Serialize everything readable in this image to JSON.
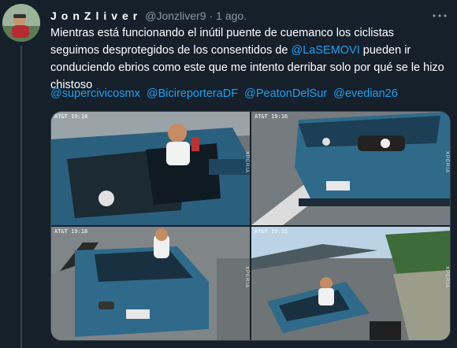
{
  "author": {
    "display_name": "JonZliver",
    "handle": "@Jonzliver9",
    "separator": "·",
    "time": "1 ago."
  },
  "tweet": {
    "text_part1": "Mientras está funcionando el inútil puente de cuemanco los ciclistas seguimos desprotegidos de los consentidos de ",
    "mention_inline": "@LaSEMOVI",
    "text_part2": " pueden ir conduciendo ebrios como este que me intento derribar solo por qué se le hizo chistoso",
    "mentions": [
      "@supercivicosmx",
      "@BicireporteraDF",
      "@PeatonDelSur",
      "@evedian26"
    ]
  },
  "media": [
    {
      "timestamp": "AT&T 19:18",
      "brand": "XPERIA"
    },
    {
      "timestamp": "AT&T 19:16",
      "brand": "XPERIA"
    },
    {
      "timestamp": "AT&T 19:18",
      "brand": "XPERIA"
    },
    {
      "timestamp": "AT&T 19:15",
      "brand": "XPERIA"
    }
  ],
  "colors": {
    "background": "#15202b",
    "link": "#1da1f2",
    "muted": "#8899a6",
    "border": "#38444d"
  }
}
